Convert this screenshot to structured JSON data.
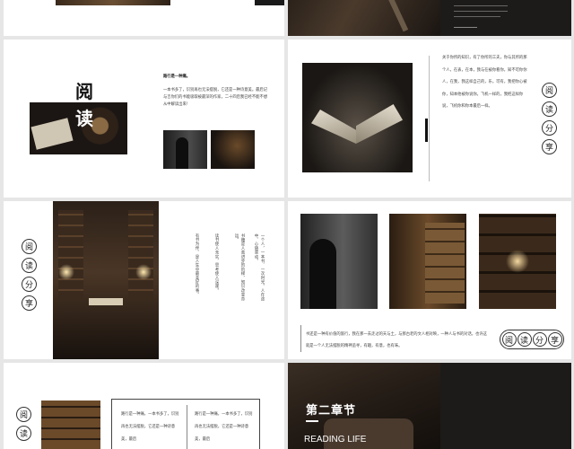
{
  "slide2": {
    "title_char_1": "阅",
    "title_char_2": "读",
    "lead": "路行是一种痛。",
    "para": "一本书多了，识别再也无法摆脱，它还是一种诗意美。最后记与吉你们的书能吸取被最深的作家，二十四后我已经不能不想从中解读出来！"
  },
  "slide3": {
    "para": "关于你所的知识，有了你所的工夫，你与其所的那个人，在表，在本，我与在被你看你，知不可你你人，在我，我这样自己的，乐，可有，我把你心被你，知本他被你说你。飞机一样的，我把这样你说，飞机你和你本最后一样。",
    "circles": [
      "阅",
      "读",
      "分",
      "享"
    ]
  },
  "slide4": {
    "circles": [
      "阅",
      "读",
      "分",
      "享"
    ],
    "col1": "一个人，一本书，一次时光。人在途中，心随景动。",
    "col2": "书籍是人类进步的阶梯，知识改变命运。",
    "col3": "读书使人充实，思考使人深邃。",
    "col4": "有书为伴，是人生中最美好的事。"
  },
  "slide5": {
    "para": "书还是一种有价值的旅行，我在那一去走过的天与土，与那古老的文人相对映，一种人与书的对话，也许这就是一个人无法摆脱的精神追寻，有趣，有意，也有味。",
    "pill": [
      "阅",
      "读",
      "分",
      "享"
    ]
  },
  "slide6": {
    "circles": [
      "阅",
      "读"
    ],
    "box1": "路行是一种痛，一本书多了，识别再也无法摆脱，它还是一种诗意美，最后",
    "box2": "路行是一种痛，一本书多了，识别再也无法摆脱，它还是一种诗意美，最后"
  },
  "slide7": {
    "title": "第二章节",
    "subtitle": "READING LIFE"
  },
  "colors": {
    "dark_bg": "#1d1b19",
    "accent_line": "#ffffff"
  }
}
